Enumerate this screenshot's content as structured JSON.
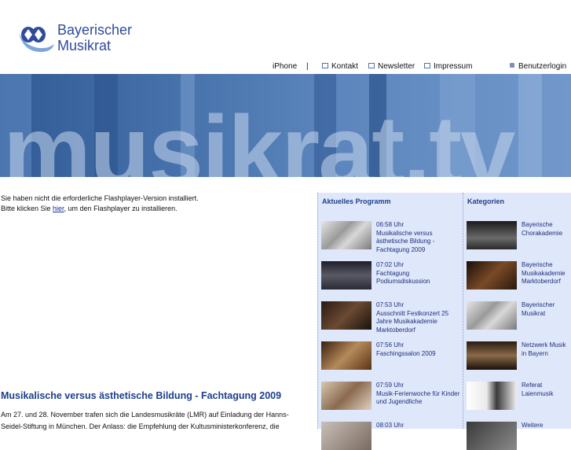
{
  "logo": {
    "line1": "Bayerischer",
    "line2": "Musikrat"
  },
  "nav": {
    "iphone": "iPhone",
    "sep": "|",
    "kontakt": "Kontakt",
    "newsletter": "Newsletter",
    "impressum": "Impressum",
    "login": "Benutzerlogin"
  },
  "banner": {
    "text": "musikrat.tv"
  },
  "flash": {
    "line1": "Sie haben nicht die erforderliche Flashplayer-Version installiert.",
    "prefix": "Bitte klicken Sie ",
    "link": "hier",
    "suffix": ", um den Flashplayer zu installieren."
  },
  "article": {
    "title": "Musikalische versus ästhetische Bildung - Fachtagung 2009",
    "text": "Am 27. und 28. November trafen sich die Landesmusikräte (LMR) auf Einladung der Hanns-Seidel-Stiftung in München. Der Anlass: die Empfehlung der Kultusministerkonferenz, die"
  },
  "program": {
    "heading": "Aktuelles Programm",
    "items": [
      {
        "time": "06:58 Uhr",
        "title": "Musikalische versus ästhetische Bildung - Fachtagung 2009"
      },
      {
        "time": "07:02 Uhr",
        "title": "Fachtagung Podiumsdiskussion"
      },
      {
        "time": "07:53 Uhr",
        "title": "Ausschnitt Festkonzert 25 Jahre Musikakademie Marktoberdorf"
      },
      {
        "time": "07:56 Uhr",
        "title": "Faschingssalon 2009"
      },
      {
        "time": "07:59 Uhr",
        "title": "Musik-Ferienwoche für Kinder und Jugendliche"
      },
      {
        "time": "08:03 Uhr",
        "title": ""
      }
    ]
  },
  "categories": {
    "heading": "Kategorien",
    "items": [
      {
        "title": "Bayerische Chorakademie"
      },
      {
        "title": "Bayerische Musikakademie Marktoberdorf"
      },
      {
        "title": "Bayerischer Musikrat"
      },
      {
        "title": "Netzwerk Musik in Bayern"
      },
      {
        "title": "Referat Laienmusik"
      },
      {
        "title": "Weitere"
      }
    ]
  },
  "colors": {
    "accent": "#2f4c9c",
    "panel": "#dfe7fb"
  }
}
